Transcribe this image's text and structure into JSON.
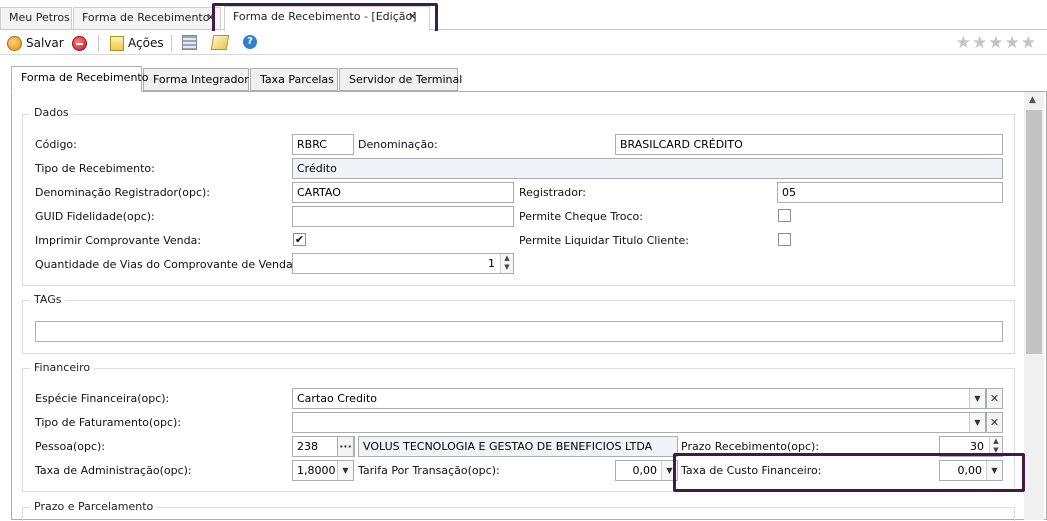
{
  "doc_tabs": [
    {
      "label": "Meu Petros"
    },
    {
      "label": "Forma de Recebimento"
    },
    {
      "label": "Forma de Recebimento - [Edição]"
    }
  ],
  "toolbar": {
    "save_label": "Salvar",
    "actions_label": "Ações",
    "rating": "★★★★★"
  },
  "page_tabs": [
    {
      "label": "Forma de Recebimento"
    },
    {
      "label": "Forma Integrador"
    },
    {
      "label": "Taxa Parcelas"
    },
    {
      "label": "Servidor de Terminal"
    }
  ],
  "dados": {
    "title": "Dados",
    "codigo_label": "Código:",
    "codigo_value": "RBRC",
    "denominacao_label": "Denominação:",
    "denominacao_value": "BRASILCARD CRÉDITO",
    "tipo_label": "Tipo de Recebimento:",
    "tipo_value": "Crédito",
    "den_reg_label": "Denominação Registrador(opc):",
    "den_reg_value": "CARTAO",
    "registrador_label": "Registrador:",
    "registrador_value": "05",
    "guid_label": "GUID Fidelidade(opc):",
    "guid_value": "",
    "cheque_troco_label": "Permite Cheque Troco:",
    "imprimir_label": "Imprimir Comprovante Venda:",
    "liquidar_label": "Permite Liquidar Titulo Cliente:",
    "vias_label": "Quantidade de Vias do Comprovante de Venda(opc):",
    "vias_value": "1"
  },
  "tags": {
    "title": "TAGs",
    "value": ""
  },
  "financeiro": {
    "title": "Financeiro",
    "especie_label": "Espécie Financeira(opc):",
    "especie_value": "Cartao Credito",
    "faturamento_label": "Tipo de Faturamento(opc):",
    "faturamento_value": "",
    "pessoa_label": "Pessoa(opc):",
    "pessoa_code": "238",
    "pessoa_name": "VOLUS TECNOLOGIA E GESTAO DE BENEFICIOS LTDA",
    "prazo_label": "Prazo Recebimento(opc):",
    "prazo_value": "30",
    "taxa_adm_label": "Taxa de Administração(opc):",
    "taxa_adm_value": "1,8000",
    "tarifa_label": "Tarifa Por Transação(opc):",
    "tarifa_value": "0,00",
    "custo_label": "Taxa de Custo Financeiro:",
    "custo_value": "0,00"
  },
  "prazo_parcelamento": {
    "title": "Prazo e Parcelamento"
  },
  "icons": {
    "ellipsis": "···",
    "check": "✔",
    "close": "✕",
    "down": "▼",
    "up_arrow": "▲"
  }
}
